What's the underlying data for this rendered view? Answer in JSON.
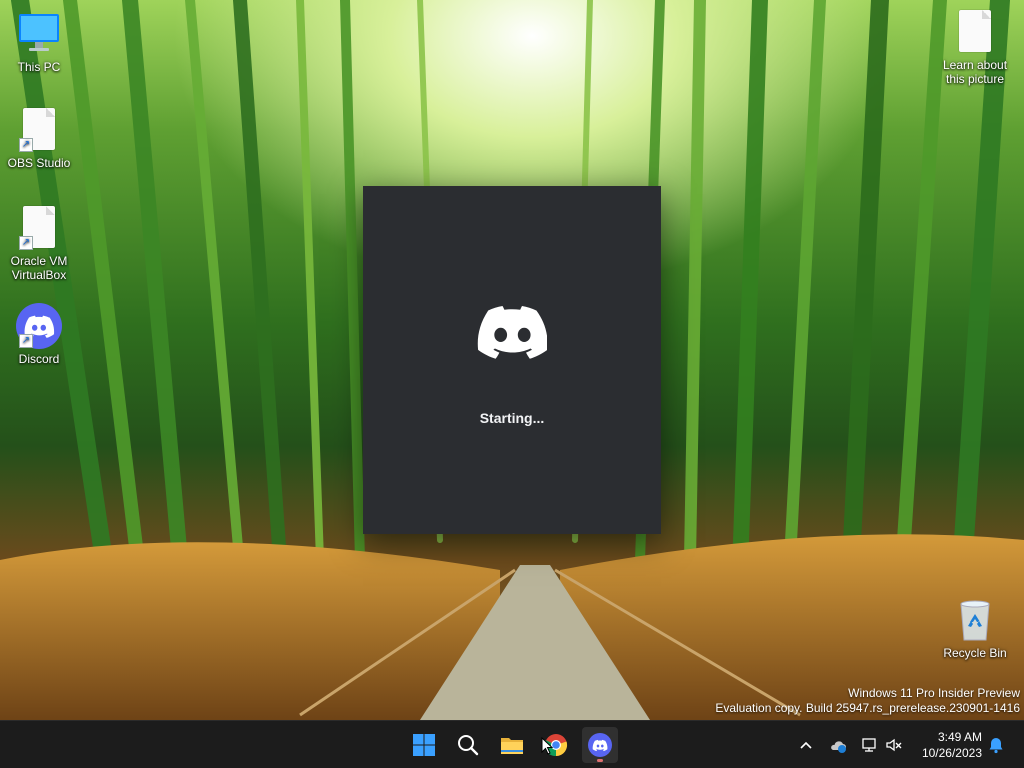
{
  "desktop": {
    "icons": [
      {
        "label": "This PC",
        "icon": "monitor-icon"
      },
      {
        "label": "OBS Studio",
        "icon": "document-icon"
      },
      {
        "label": "Oracle VM VirtualBox",
        "icon": "document-icon"
      },
      {
        "label": "Discord",
        "icon": "discord-icon"
      },
      {
        "label": "Learn about this picture",
        "icon": "document-icon"
      },
      {
        "label": "Recycle Bin",
        "icon": "recycle-bin-icon"
      }
    ]
  },
  "splash": {
    "status": "Starting...",
    "background_color": "#2b2d31"
  },
  "watermark": {
    "line1": "Windows 11 Pro Insider Preview",
    "line2": "Evaluation copy. Build 25947.rs_prerelease.230901-1416"
  },
  "taskbar": {
    "pinned": [
      {
        "name": "start",
        "icon": "windows-logo-icon"
      },
      {
        "name": "search",
        "icon": "search-icon"
      },
      {
        "name": "file-explorer",
        "icon": "folder-icon"
      },
      {
        "name": "chrome",
        "icon": "chrome-icon"
      },
      {
        "name": "discord",
        "icon": "discord-icon",
        "active": true
      }
    ],
    "tray": {
      "time": "3:49 AM",
      "date": "10/26/2023"
    }
  },
  "colors": {
    "discord_blurple": "#5865f2",
    "taskbar_bg": "#1c1c1c",
    "windows_blue": "#0a84ff"
  }
}
